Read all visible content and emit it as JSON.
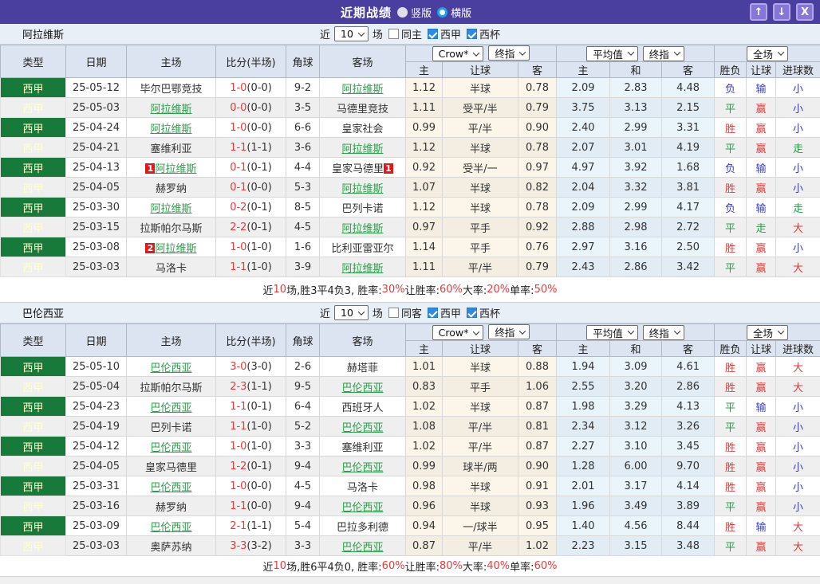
{
  "titlebar": {
    "title": "近期战绩",
    "radios": [
      {
        "label": "竖版",
        "selected": false,
        "style": "solid"
      },
      {
        "label": "横版",
        "selected": true,
        "style": "ring"
      }
    ],
    "buttons": {
      "up": "↑",
      "down": "↓",
      "close": "X"
    }
  },
  "colors": {
    "accent_purple": "#4a3f9e",
    "league_green": "#17793a",
    "team_link_green": "#2ba04a",
    "score_red": "#e43b3b",
    "win_red": "#e43b3b",
    "draw_green": "#26a04a",
    "loss_blue": "#3a3ad0"
  },
  "table_header": {
    "main": [
      "类型",
      "日期",
      "主场",
      "比分(半场)",
      "角球",
      "客场"
    ],
    "sub": [
      "主",
      "让球",
      "客",
      "主",
      "和",
      "客",
      "胜负",
      "让球",
      "进球数"
    ]
  },
  "sections": [
    {
      "team": "阿拉维斯",
      "filter": {
        "near": "近",
        "count": "10",
        "unit": "场",
        "same": {
          "label": "同主",
          "checked": false
        },
        "league": {
          "label": "西甲",
          "checked": true
        },
        "cup": {
          "label": "西杯",
          "checked": true
        }
      },
      "dropdowns": {
        "bookmaker": "Crow*",
        "asian_final": "终指",
        "euro_avg": "平均值",
        "euro_final": "终指",
        "scope": "全场"
      },
      "rows": [
        {
          "league": "西甲",
          "date": "25-05-12",
          "home": {
            "name": "毕尔巴鄂竞技",
            "focus": false
          },
          "score": "1-0",
          "half": "(0-0)",
          "corners": "9-2",
          "away": {
            "name": "阿拉维斯",
            "focus": true
          },
          "asian": [
            "1.12",
            "半球",
            "0.78"
          ],
          "euro": [
            "2.09",
            "2.83",
            "4.48"
          ],
          "outcome": [
            {
              "t": "负",
              "c": "blue"
            },
            {
              "t": "输",
              "c": "blue"
            },
            {
              "t": "小",
              "c": "blue"
            }
          ]
        },
        {
          "league": "西甲",
          "date": "25-05-03",
          "home": {
            "name": "阿拉维斯",
            "focus": true
          },
          "score": "0-0",
          "half": "(0-0)",
          "corners": "3-5",
          "away": {
            "name": "马德里竞技",
            "focus": false
          },
          "asian": [
            "1.11",
            "受平/半",
            "0.79"
          ],
          "euro": [
            "3.75",
            "3.13",
            "2.15"
          ],
          "outcome": [
            {
              "t": "平",
              "c": "green"
            },
            {
              "t": "赢",
              "c": "red"
            },
            {
              "t": "小",
              "c": "blue"
            }
          ]
        },
        {
          "league": "西甲",
          "date": "25-04-24",
          "home": {
            "name": "阿拉维斯",
            "focus": true
          },
          "score": "1-0",
          "half": "(0-0)",
          "corners": "6-6",
          "away": {
            "name": "皇家社会",
            "focus": false
          },
          "asian": [
            "0.99",
            "平/半",
            "0.90"
          ],
          "euro": [
            "2.40",
            "2.99",
            "3.31"
          ],
          "outcome": [
            {
              "t": "胜",
              "c": "red"
            },
            {
              "t": "赢",
              "c": "red"
            },
            {
              "t": "小",
              "c": "blue"
            }
          ]
        },
        {
          "league": "西甲",
          "date": "25-04-21",
          "home": {
            "name": "塞维利亚",
            "focus": false
          },
          "score": "1-1",
          "half": "(1-1)",
          "corners": "3-6",
          "away": {
            "name": "阿拉维斯",
            "focus": true
          },
          "asian": [
            "1.12",
            "半球",
            "0.78"
          ],
          "euro": [
            "2.07",
            "3.01",
            "4.19"
          ],
          "outcome": [
            {
              "t": "平",
              "c": "green"
            },
            {
              "t": "赢",
              "c": "red"
            },
            {
              "t": "走",
              "c": "green"
            }
          ]
        },
        {
          "league": "西甲",
          "date": "25-04-13",
          "home": {
            "name": "阿拉维斯",
            "focus": true,
            "badge": "1"
          },
          "score": "0-1",
          "half": "(0-1)",
          "corners": "4-4",
          "away": {
            "name": "皇家马德里",
            "focus": false,
            "badge": "1"
          },
          "asian": [
            "0.92",
            "受半/一",
            "0.97"
          ],
          "euro": [
            "4.97",
            "3.92",
            "1.68"
          ],
          "outcome": [
            {
              "t": "负",
              "c": "blue"
            },
            {
              "t": "输",
              "c": "blue"
            },
            {
              "t": "小",
              "c": "blue"
            }
          ]
        },
        {
          "league": "西甲",
          "date": "25-04-05",
          "home": {
            "name": "赫罗纳",
            "focus": false
          },
          "score": "0-1",
          "half": "(0-0)",
          "corners": "5-3",
          "away": {
            "name": "阿拉维斯",
            "focus": true
          },
          "asian": [
            "1.07",
            "半球",
            "0.82"
          ],
          "euro": [
            "2.04",
            "3.32",
            "3.81"
          ],
          "outcome": [
            {
              "t": "胜",
              "c": "red"
            },
            {
              "t": "赢",
              "c": "red"
            },
            {
              "t": "小",
              "c": "blue"
            }
          ]
        },
        {
          "league": "西甲",
          "date": "25-03-30",
          "home": {
            "name": "阿拉维斯",
            "focus": true
          },
          "score": "0-2",
          "half": "(0-1)",
          "corners": "8-5",
          "away": {
            "name": "巴列卡诺",
            "focus": false
          },
          "asian": [
            "1.12",
            "半球",
            "0.78"
          ],
          "euro": [
            "2.09",
            "2.99",
            "4.17"
          ],
          "outcome": [
            {
              "t": "负",
              "c": "blue"
            },
            {
              "t": "输",
              "c": "blue"
            },
            {
              "t": "走",
              "c": "green"
            }
          ]
        },
        {
          "league": "西甲",
          "date": "25-03-15",
          "home": {
            "name": "拉斯帕尔马斯",
            "focus": false
          },
          "score": "2-2",
          "half": "(0-1)",
          "corners": "4-5",
          "away": {
            "name": "阿拉维斯",
            "focus": true
          },
          "asian": [
            "0.97",
            "平手",
            "0.92"
          ],
          "euro": [
            "2.88",
            "2.98",
            "2.72"
          ],
          "outcome": [
            {
              "t": "平",
              "c": "green"
            },
            {
              "t": "走",
              "c": "green"
            },
            {
              "t": "大",
              "c": "red"
            }
          ]
        },
        {
          "league": "西甲",
          "date": "25-03-08",
          "home": {
            "name": "阿拉维斯",
            "focus": true,
            "badge": "2"
          },
          "score": "1-0",
          "half": "(1-0)",
          "corners": "1-6",
          "away": {
            "name": "比利亚雷亚尔",
            "focus": false
          },
          "asian": [
            "1.14",
            "平手",
            "0.76"
          ],
          "euro": [
            "2.97",
            "3.16",
            "2.50"
          ],
          "outcome": [
            {
              "t": "胜",
              "c": "red"
            },
            {
              "t": "赢",
              "c": "red"
            },
            {
              "t": "小",
              "c": "blue"
            }
          ]
        },
        {
          "league": "西甲",
          "date": "25-03-03",
          "home": {
            "name": "马洛卡",
            "focus": false
          },
          "score": "1-1",
          "half": "(1-0)",
          "corners": "3-9",
          "away": {
            "name": "阿拉维斯",
            "focus": true
          },
          "asian": [
            "1.11",
            "平/半",
            "0.79"
          ],
          "euro": [
            "2.43",
            "2.86",
            "3.42"
          ],
          "outcome": [
            {
              "t": "平",
              "c": "green"
            },
            {
              "t": "赢",
              "c": "red"
            },
            {
              "t": "大",
              "c": "red"
            }
          ]
        }
      ],
      "summary": [
        {
          "text": "近",
          "red": false
        },
        {
          "text": "10",
          "red": true
        },
        {
          "text": "场,胜3平4负3, 胜率:",
          "red": false
        },
        {
          "text": "30%",
          "red": true
        },
        {
          "text": " 让胜率:",
          "red": false
        },
        {
          "text": "60%",
          "red": true
        },
        {
          "text": " 大率:",
          "red": false
        },
        {
          "text": "20%",
          "red": true
        },
        {
          "text": " 单率:",
          "red": false
        },
        {
          "text": "50%",
          "red": true
        }
      ]
    },
    {
      "team": "巴伦西亚",
      "filter": {
        "near": "近",
        "count": "10",
        "unit": "场",
        "same": {
          "label": "同客",
          "checked": false
        },
        "league": {
          "label": "西甲",
          "checked": true
        },
        "cup": {
          "label": "西杯",
          "checked": true
        }
      },
      "dropdowns": {
        "bookmaker": "Crow*",
        "asian_final": "终指",
        "euro_avg": "平均值",
        "euro_final": "终指",
        "scope": "全场"
      },
      "rows": [
        {
          "league": "西甲",
          "date": "25-05-10",
          "home": {
            "name": "巴伦西亚",
            "focus": true
          },
          "score": "3-0",
          "half": "(3-0)",
          "corners": "2-6",
          "away": {
            "name": "赫塔菲",
            "focus": false
          },
          "asian": [
            "1.01",
            "半球",
            "0.88"
          ],
          "euro": [
            "1.94",
            "3.09",
            "4.61"
          ],
          "outcome": [
            {
              "t": "胜",
              "c": "red"
            },
            {
              "t": "赢",
              "c": "red"
            },
            {
              "t": "大",
              "c": "red"
            }
          ]
        },
        {
          "league": "西甲",
          "date": "25-05-04",
          "home": {
            "name": "拉斯帕尔马斯",
            "focus": false
          },
          "score": "2-3",
          "half": "(1-1)",
          "corners": "9-5",
          "away": {
            "name": "巴伦西亚",
            "focus": true
          },
          "asian": [
            "0.83",
            "平手",
            "1.06"
          ],
          "euro": [
            "2.55",
            "3.20",
            "2.86"
          ],
          "outcome": [
            {
              "t": "胜",
              "c": "red"
            },
            {
              "t": "赢",
              "c": "red"
            },
            {
              "t": "大",
              "c": "red"
            }
          ]
        },
        {
          "league": "西甲",
          "date": "25-04-23",
          "home": {
            "name": "巴伦西亚",
            "focus": true
          },
          "score": "1-1",
          "half": "(0-1)",
          "corners": "6-4",
          "away": {
            "name": "西班牙人",
            "focus": false
          },
          "asian": [
            "1.02",
            "半球",
            "0.87"
          ],
          "euro": [
            "1.98",
            "3.29",
            "4.13"
          ],
          "outcome": [
            {
              "t": "平",
              "c": "green"
            },
            {
              "t": "输",
              "c": "blue"
            },
            {
              "t": "小",
              "c": "blue"
            }
          ]
        },
        {
          "league": "西甲",
          "date": "25-04-19",
          "home": {
            "name": "巴列卡诺",
            "focus": false
          },
          "score": "1-1",
          "half": "(1-0)",
          "corners": "5-2",
          "away": {
            "name": "巴伦西亚",
            "focus": true
          },
          "asian": [
            "1.08",
            "平/半",
            "0.81"
          ],
          "euro": [
            "2.34",
            "3.12",
            "3.26"
          ],
          "outcome": [
            {
              "t": "平",
              "c": "green"
            },
            {
              "t": "赢",
              "c": "red"
            },
            {
              "t": "小",
              "c": "blue"
            }
          ]
        },
        {
          "league": "西甲",
          "date": "25-04-12",
          "home": {
            "name": "巴伦西亚",
            "focus": true
          },
          "score": "1-0",
          "half": "(1-0)",
          "corners": "3-3",
          "away": {
            "name": "塞维利亚",
            "focus": false
          },
          "asian": [
            "1.02",
            "平/半",
            "0.87"
          ],
          "euro": [
            "2.27",
            "3.10",
            "3.45"
          ],
          "outcome": [
            {
              "t": "胜",
              "c": "red"
            },
            {
              "t": "赢",
              "c": "red"
            },
            {
              "t": "小",
              "c": "blue"
            }
          ]
        },
        {
          "league": "西甲",
          "date": "25-04-05",
          "home": {
            "name": "皇家马德里",
            "focus": false
          },
          "score": "1-2",
          "half": "(0-1)",
          "corners": "9-4",
          "away": {
            "name": "巴伦西亚",
            "focus": true
          },
          "asian": [
            "0.99",
            "球半/两",
            "0.90"
          ],
          "euro": [
            "1.28",
            "6.00",
            "9.70"
          ],
          "outcome": [
            {
              "t": "胜",
              "c": "red"
            },
            {
              "t": "赢",
              "c": "red"
            },
            {
              "t": "小",
              "c": "blue"
            }
          ]
        },
        {
          "league": "西甲",
          "date": "25-03-31",
          "home": {
            "name": "巴伦西亚",
            "focus": true
          },
          "score": "1-0",
          "half": "(0-0)",
          "corners": "4-5",
          "away": {
            "name": "马洛卡",
            "focus": false
          },
          "asian": [
            "0.98",
            "半球",
            "0.91"
          ],
          "euro": [
            "2.01",
            "3.17",
            "4.14"
          ],
          "outcome": [
            {
              "t": "胜",
              "c": "red"
            },
            {
              "t": "赢",
              "c": "red"
            },
            {
              "t": "小",
              "c": "blue"
            }
          ]
        },
        {
          "league": "西甲",
          "date": "25-03-16",
          "home": {
            "name": "赫罗纳",
            "focus": false
          },
          "score": "1-1",
          "half": "(0-0)",
          "corners": "9-4",
          "away": {
            "name": "巴伦西亚",
            "focus": true
          },
          "asian": [
            "0.96",
            "半球",
            "0.93"
          ],
          "euro": [
            "1.96",
            "3.49",
            "3.89"
          ],
          "outcome": [
            {
              "t": "平",
              "c": "green"
            },
            {
              "t": "赢",
              "c": "red"
            },
            {
              "t": "小",
              "c": "blue"
            }
          ]
        },
        {
          "league": "西甲",
          "date": "25-03-09",
          "home": {
            "name": "巴伦西亚",
            "focus": true
          },
          "score": "2-1",
          "half": "(1-1)",
          "corners": "5-4",
          "away": {
            "name": "巴拉多利德",
            "focus": false
          },
          "asian": [
            "0.94",
            "一/球半",
            "0.95"
          ],
          "euro": [
            "1.40",
            "4.56",
            "8.44"
          ],
          "outcome": [
            {
              "t": "胜",
              "c": "red"
            },
            {
              "t": "输",
              "c": "blue"
            },
            {
              "t": "大",
              "c": "red"
            }
          ]
        },
        {
          "league": "西甲",
          "date": "25-03-03",
          "home": {
            "name": "奥萨苏纳",
            "focus": false
          },
          "score": "3-3",
          "half": "(3-2)",
          "corners": "3-3",
          "away": {
            "name": "巴伦西亚",
            "focus": true
          },
          "asian": [
            "0.87",
            "平/半",
            "1.02"
          ],
          "euro": [
            "2.23",
            "3.15",
            "3.48"
          ],
          "outcome": [
            {
              "t": "平",
              "c": "green"
            },
            {
              "t": "赢",
              "c": "red"
            },
            {
              "t": "大",
              "c": "red"
            }
          ]
        }
      ],
      "summary": [
        {
          "text": "近",
          "red": false
        },
        {
          "text": "10",
          "red": true
        },
        {
          "text": "场,胜6平4负0, 胜率:",
          "red": false
        },
        {
          "text": "60%",
          "red": true
        },
        {
          "text": " 让胜率:",
          "red": false
        },
        {
          "text": "80%",
          "red": true
        },
        {
          "text": " 大率:",
          "red": false
        },
        {
          "text": "40%",
          "red": true
        },
        {
          "text": " 单率:",
          "red": false
        },
        {
          "text": "60%",
          "red": true
        }
      ]
    }
  ]
}
